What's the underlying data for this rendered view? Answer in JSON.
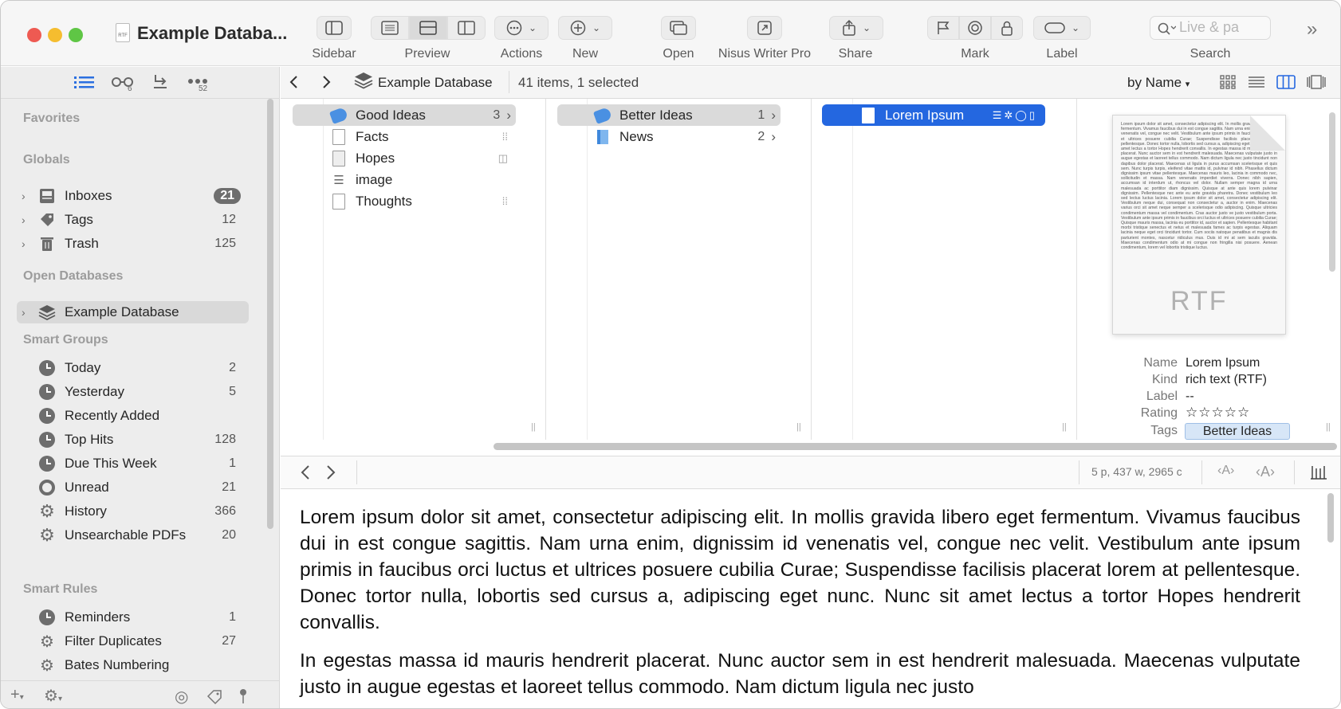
{
  "window": {
    "title": "Example Databa...",
    "doc_badge": "RTF"
  },
  "toolbar": {
    "buttons": [
      {
        "label": "Sidebar"
      },
      {
        "label": "Preview"
      },
      {
        "label": "Actions"
      },
      {
        "label": "New"
      },
      {
        "label": "Open"
      },
      {
        "label": "Nisus Writer Pro"
      },
      {
        "label": "Share"
      },
      {
        "label": "Mark"
      },
      {
        "label": "Label"
      },
      {
        "label": "Search"
      }
    ],
    "search_placeholder": "Live & pa"
  },
  "sidebar": {
    "top_badges": {
      "reading_list": "6",
      "more": "52"
    },
    "sections": {
      "favorites": "Favorites",
      "globals": "Globals",
      "open_databases": "Open Databases",
      "smart_groups": "Smart Groups",
      "smart_rules": "Smart Rules"
    },
    "globals": [
      {
        "label": "Inboxes",
        "count": "21"
      },
      {
        "label": "Tags",
        "count": "12"
      },
      {
        "label": "Trash",
        "count": "125"
      }
    ],
    "databases": [
      {
        "label": "Example Database",
        "selected": true
      }
    ],
    "smart_groups": [
      {
        "label": "Today",
        "count": "2",
        "icon": "clock-icon"
      },
      {
        "label": "Yesterday",
        "count": "5",
        "icon": "clock-icon"
      },
      {
        "label": "Recently Added",
        "count": "",
        "icon": "clock-icon"
      },
      {
        "label": "Top Hits",
        "count": "128",
        "icon": "clock-icon"
      },
      {
        "label": "Due This Week",
        "count": "1",
        "icon": "clock-icon"
      },
      {
        "label": "Unread",
        "count": "21",
        "icon": "ring-icon"
      },
      {
        "label": "History",
        "count": "366",
        "icon": "gear-icon"
      },
      {
        "label": "Unsearchable PDFs",
        "count": "20",
        "icon": "gear-icon"
      }
    ],
    "smart_rules": [
      {
        "label": "Reminders",
        "count": "1",
        "icon": "clock-icon"
      },
      {
        "label": "Filter Duplicates",
        "count": "27",
        "icon": "gears-icon"
      },
      {
        "label": "Bates Numbering",
        "count": "",
        "icon": "gears-icon"
      }
    ]
  },
  "pathbar": {
    "crumb": "Example Database",
    "status": "41 items, 1 selected",
    "sort": "by Name"
  },
  "browser": {
    "column1": [
      {
        "label": "Good Ideas",
        "count": "3",
        "kind": "tag-group",
        "state": "parent"
      },
      {
        "label": "Facts",
        "count": "",
        "kind": "document"
      },
      {
        "label": "Hopes",
        "count": "",
        "kind": "document"
      },
      {
        "label": "image",
        "count": "",
        "kind": "text"
      },
      {
        "label": "Thoughts",
        "count": "",
        "kind": "document"
      }
    ],
    "column2": [
      {
        "label": "Better Ideas",
        "count": "1",
        "kind": "tag-group",
        "state": "parent"
      },
      {
        "label": "News",
        "count": "2",
        "kind": "group"
      }
    ],
    "column3": [
      {
        "label": "Lorem Ipsum",
        "kind": "rtf",
        "state": "selected"
      }
    ]
  },
  "inspector": {
    "thumbnail_text": "Lorem ipsum dolor sit amet, consectetur adipiscing elit. In mollis gravida libero eget fermentum. Vivamus faucibus dui in est congue sagittis. Nam urna enim, dignissim id venenatis vel, congue nec velit. Vestibulum ante ipsum primis in faucibus orci luctus et ultrices posuere cubilia Curae; Suspendisse facilisis placerat lorem at pellentesque. Donec tortor nulla, lobortis sed cursus a, adipiscing eget nunc. Nunc sit amet lectus a tortor Hopes hendrerit convallis. In egestas massa id mauris hendrerit placerat. Nunc auctor sem in est hendrerit malesuada. Maecenas vulputate justo in augue egestas et laoreet tellus commodo. Nam dictum ligula nec justo tincidunt non dapibus dolor placerat. Maecenas ut ligula in purus accumsan scelerisque et quis sem. Nunc turpis turpis, eleifend vitae mattis id, pulvinar id nibh. Phasellus dictum dignissim ipsum vitae pellentesque. Maecenas mauris leo, lacinia in commodo nec, sollicitudin et massa. Nam venenatis imperdiet viverra. Donec nibh sapien, accumsan id interdum ut, rhoncus vel dolor. Nullam semper magna id urna malesuada ac porttitor diam dignissim. Quisque at ante quis lorem pulvinar dignissim. Pellentesque nec ante eu ante gravida pharetra. Donec vestibulum leo sed lectus luctus lacinia. Lorem ipsum dolor sit amet, consectetur adipiscing elit. Vestibulum neque dui, consequat non consectetur a, auctor in enim. Maecenas varius orci sit amet neque semper a scelerisque odio adipiscing. Quisque ultricies condimentum massa vel condimentum. Cras auctor justo ve justo vestibulum porta. Vestibulum ante ipsum primis in faucibus orci luctus et ultrices posuere cubilia Curae; Quisque mauris massa, lacinia eu porttitor id, auctor et sapien. Pellentesque habitant morbi tristique senectus et netus et malesuada fames ac turpis egestas. Aliquam lacinia neque eget orci tincidunt tortor. Cum sociis natoque penatibus et magnis dis parturient montes, nascetur ridiculus mus. Duis id mi at sem iaculis gravida. Maecenas condimentum odio at mi congue non fringilla nisi posuere. Aenean condimentum, lorem vel lobortis tristique luctus.",
    "thumbnail_kind": "RTF",
    "props": [
      {
        "key": "Name",
        "value": "Lorem Ipsum"
      },
      {
        "key": "Kind",
        "value": "rich text (RTF)"
      },
      {
        "key": "Label",
        "value": "--"
      },
      {
        "key": "Rating",
        "value": "☆☆☆☆☆"
      },
      {
        "key": "Tags",
        "value": "Better Ideas"
      }
    ]
  },
  "editor": {
    "stats": "5 p, 437 w, 2965 c",
    "paragraphs": [
      "Lorem ipsum dolor sit amet, consectetur adipiscing elit. In mollis gravida libero eget fermentum. Vivamus faucibus dui in est congue sagittis. Nam urna enim, dignissim id venenatis vel, congue nec velit. Vestibulum ante ipsum primis in faucibus orci luctus et ultrices posuere cubilia Curae; Suspendisse facilisis placerat lorem at pellentesque. Donec tortor nulla, lobortis sed cursus a, adipiscing eget nunc. Nunc sit amet lectus a tortor Hopes hendrerit convallis.",
      "In egestas massa id mauris hendrerit placerat. Nunc auctor sem in est hendrerit malesuada. Maecenas vulputate justo in augue egestas et laoreet tellus commodo. Nam dictum ligula nec justo"
    ]
  },
  "colors": {
    "selection_blue": "#2467e0",
    "traffic_red": "#ee5a52",
    "traffic_yellow": "#f5bd2f",
    "traffic_green": "#5fc645"
  }
}
